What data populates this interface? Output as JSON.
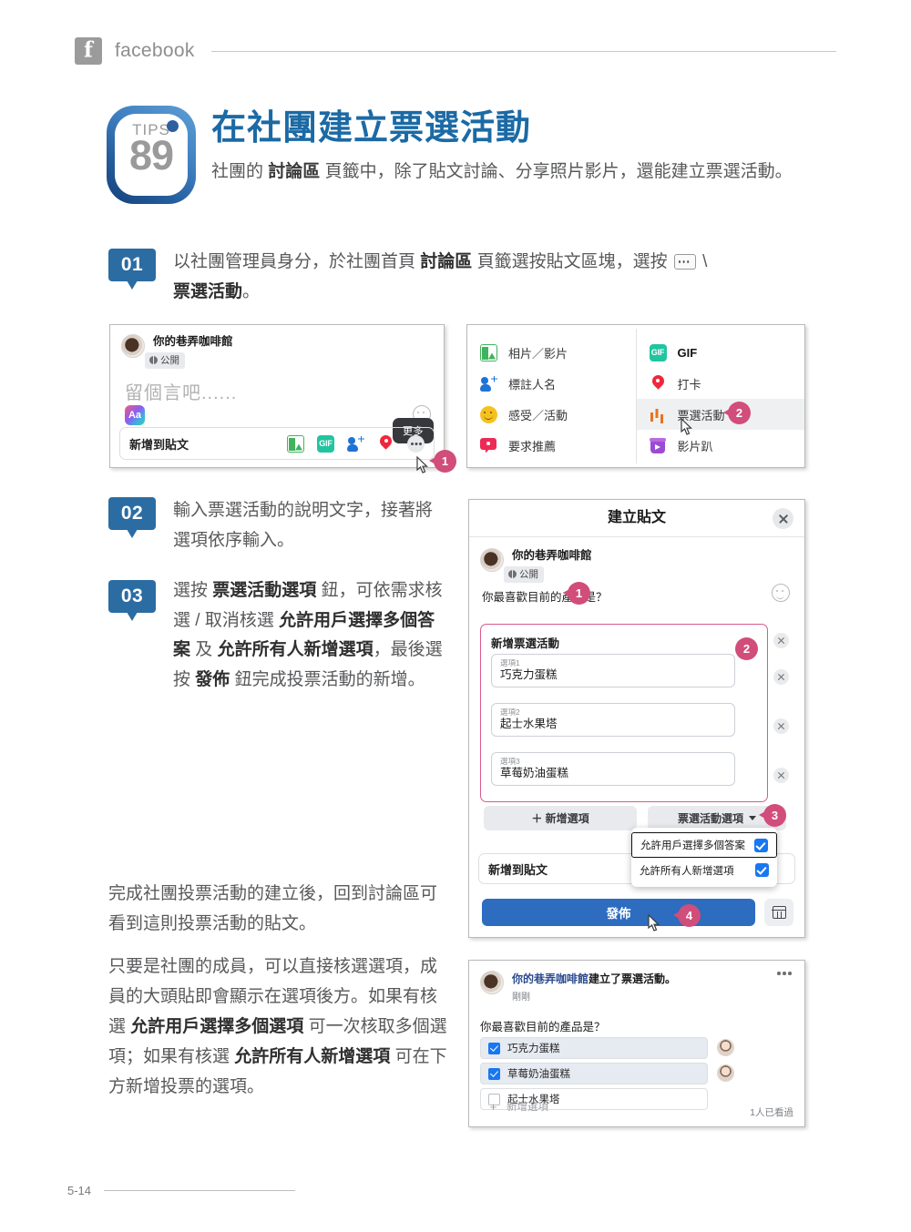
{
  "header": {
    "brand": "facebook",
    "logo_icon": "facebook-f-icon"
  },
  "tip": {
    "label": "TIPS",
    "number": "89"
  },
  "title": "在社團建立票選活動",
  "subtitle_parts": {
    "a": "社團的 ",
    "b": "討論區",
    "c": " 頁籤中，除了貼文討論、分享照片影片，還能建立票選活動。"
  },
  "steps": [
    {
      "num": "01",
      "parts": {
        "a": "以社團管理員身分，於社團首頁 ",
        "b": "討論區",
        "c": " 頁籤選按貼文區塊，選按 ",
        "d": " \\ ",
        "e": "票選活動",
        "f": "。"
      }
    },
    {
      "num": "02",
      "text": "輸入票選活動的說明文字，接著將選項依序輸入。"
    },
    {
      "num": "03",
      "parts": {
        "a": "選按 ",
        "b": "票選活動選項",
        "c": " 鈕，可依需求核選 / 取消核選 ",
        "d": "允許用戶選擇多個答案",
        "e": " 及 ",
        "f": "允許所有人新增選項",
        "g": "，最後選按 ",
        "h": "發佈",
        "i": " 鈕完成投票活動的新增。"
      }
    }
  ],
  "composer": {
    "page_name": "你的巷弄咖啡館",
    "privacy": "公開",
    "placeholder": "留個言吧......",
    "format_btn": "Aa",
    "add_bar_label": "新增到貼文",
    "tooltip": "更多",
    "icons": [
      "photo-video-icon",
      "gif-icon",
      "tag-people-icon",
      "location-icon",
      "more-options-icon"
    ],
    "marker": "1"
  },
  "attach_menu": {
    "left": [
      {
        "label": "相片／影片",
        "icon": "photo-video-icon"
      },
      {
        "label": "標註人名",
        "icon": "tag-people-icon"
      },
      {
        "label": "感受／活動",
        "icon": "feeling-activity-icon"
      },
      {
        "label": "要求推薦",
        "icon": "ask-recommendation-icon"
      }
    ],
    "right": [
      {
        "label": "GIF",
        "icon": "gif-icon"
      },
      {
        "label": "打卡",
        "icon": "check-in-icon"
      },
      {
        "label": "票選活動",
        "icon": "poll-icon"
      },
      {
        "label": "影片趴",
        "icon": "watch-party-icon"
      }
    ],
    "marker": "2"
  },
  "dialog": {
    "title": "建立貼文",
    "close_icon": "close-icon",
    "page_name": "你的巷弄咖啡館",
    "privacy": "公開",
    "post_text": "你最喜歡目前的產品是？",
    "marker_post": "1",
    "poll": {
      "title": "新增票選活動",
      "marker": "2",
      "options": [
        {
          "label": "選項1",
          "value": "巧克力蛋糕"
        },
        {
          "label": "選項2",
          "value": "起士水果塔"
        },
        {
          "label": "選項3",
          "value": "草莓奶油蛋糕"
        }
      ]
    },
    "add_option_btn": "＋ 新增選項",
    "poll_options_btn": "票選活動選項",
    "poll_options_marker": "3",
    "dropdown": [
      {
        "label": "允許用戶選擇多個答案",
        "checked": true
      },
      {
        "label": "允許所有人新增選項",
        "checked": true
      }
    ],
    "add_to_post_label": "新增到貼文",
    "publish_btn": "發佈",
    "publish_marker": "4",
    "calendar_icon": "calendar-icon"
  },
  "body_paragraphs": {
    "p1": "完成社團投票活動的建立後，回到討論區可看到這則投票活動的貼文。",
    "p2": {
      "a": "只要是社團的成員，可以直接核選選項，成員的大頭貼即會顯示在選項後方。如果有核選 ",
      "b": "允許用戶選擇多個選項",
      "c": " 可一次核取多個選項；如果有核選 ",
      "d": "允許所有人新增選項",
      "e": " 可在下方新增投票的選項。"
    }
  },
  "result_card": {
    "page_name": "你的巷弄咖啡館",
    "action": "建立了票選活動。",
    "time": "剛剛",
    "question": "你最喜歡目前的產品是？",
    "options": [
      {
        "label": "巧克力蛋糕",
        "checked": true,
        "avatar": true
      },
      {
        "label": "草莓奶油蛋糕",
        "checked": true,
        "avatar": true
      },
      {
        "label": "起士水果塔",
        "checked": false,
        "avatar": false
      }
    ],
    "add_option": "新增選項",
    "seen": "1人已看過",
    "more_icon": "more-options-icon"
  },
  "footer": {
    "page_number": "5-14"
  }
}
